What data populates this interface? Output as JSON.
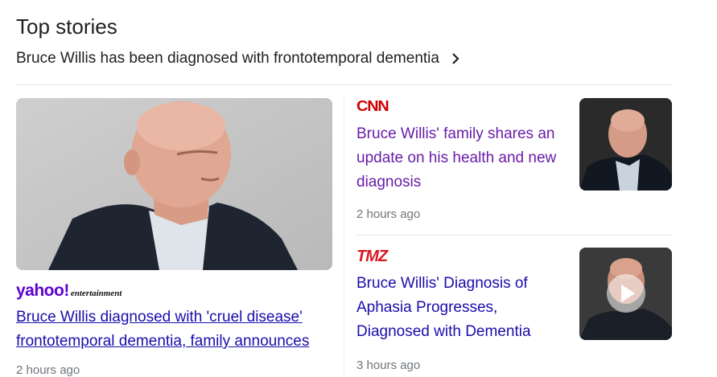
{
  "section": {
    "title": "Top stories",
    "topic": "Bruce Willis has been diagnosed with frontotemporal dementia"
  },
  "main_story": {
    "source_name": "yahoo!",
    "source_sub": "entertainment",
    "headline": "Bruce Willis diagnosed with 'cruel disease' frontotemporal dementia, family announces",
    "time": "2 hours ago",
    "image": "man-portrait-photo"
  },
  "side_stories": [
    {
      "source_name": "CNN",
      "headline": "Bruce Willis' family shares an update on his health and new diagnosis",
      "time": "2 hours ago",
      "thumbnail": "man-portrait-photo"
    },
    {
      "source_name": "TMZ",
      "headline": "Bruce Willis' Diagnosis of Aphasia Progresses, Diagnosed with Dementia",
      "time": "3 hours ago",
      "thumbnail": "video-thumbnail-with-play-icon"
    }
  ],
  "colors": {
    "link_unvisited": "#1a0dab",
    "link_visited": "#681da8",
    "meta_text": "#70757a",
    "yahoo_purple": "#5f01d1",
    "cnn_red": "#cc0000",
    "tmz_red": "#d71920"
  }
}
